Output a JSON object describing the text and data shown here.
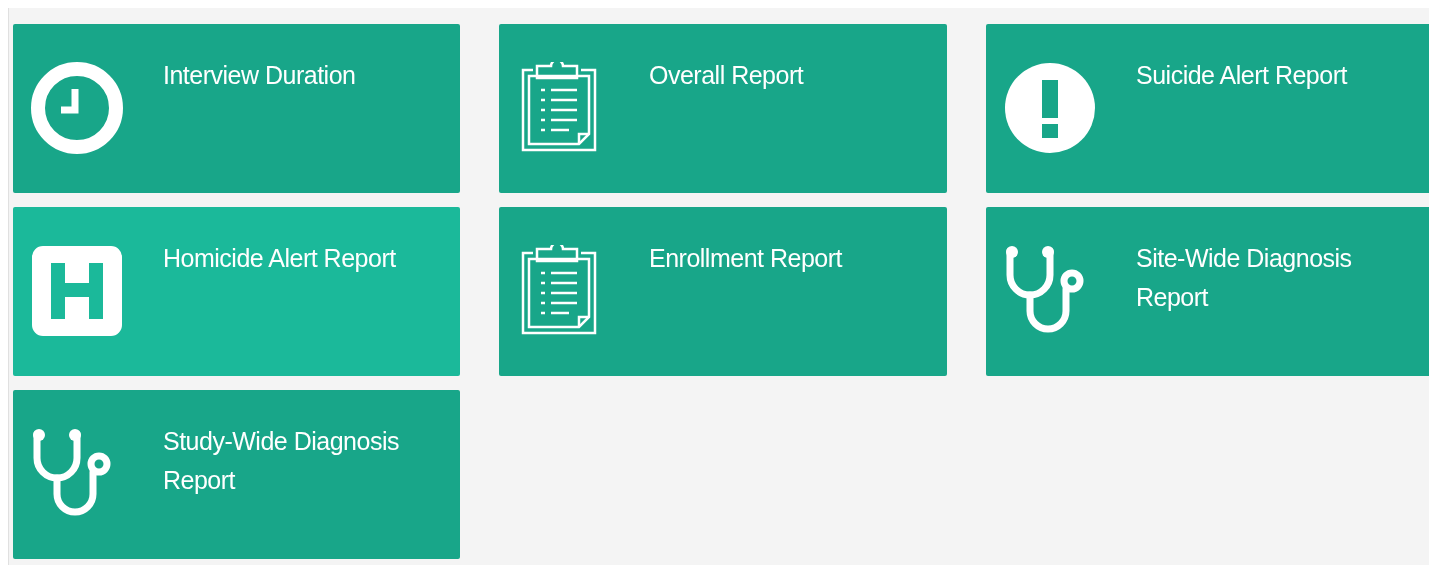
{
  "tiles": [
    {
      "label": "Interview Duration",
      "kind": "clock",
      "highlighted": false
    },
    {
      "label": "Overall Report",
      "kind": "clipboard",
      "highlighted": false
    },
    {
      "label": "Suicide Alert Report",
      "kind": "alert",
      "highlighted": false
    },
    {
      "label": "Homicide Alert Report",
      "kind": "hospital",
      "highlighted": true
    },
    {
      "label": "Enrollment Report",
      "kind": "clipboard",
      "highlighted": false
    },
    {
      "label": "Site-Wide Diagnosis Report",
      "kind": "stethoscope",
      "highlighted": false
    },
    {
      "label": "Study-Wide Diagnosis Report",
      "kind": "stethoscope",
      "highlighted": false
    }
  ]
}
